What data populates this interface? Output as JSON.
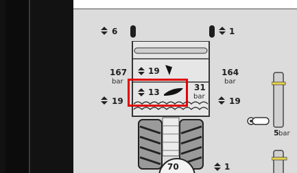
{
  "left_pressures": {
    "top": "6",
    "mid": "19"
  },
  "right_pressures": {
    "top": "1",
    "mid": "19",
    "bottom": "1"
  },
  "center": {
    "upper_value": "19",
    "lower_value": "13"
  },
  "left_bar": {
    "value": "167",
    "unit": "bar"
  },
  "right_bar": {
    "value": "164",
    "unit": "bar"
  },
  "inner_bar": {
    "value": "31",
    "unit": "bar"
  },
  "aux_bar": {
    "value": "5",
    "unit": "bar"
  },
  "speed": "70",
  "colors": {
    "highlight": "#e00000",
    "panel": "#dcdcdc",
    "accent": "#e8d44a"
  }
}
